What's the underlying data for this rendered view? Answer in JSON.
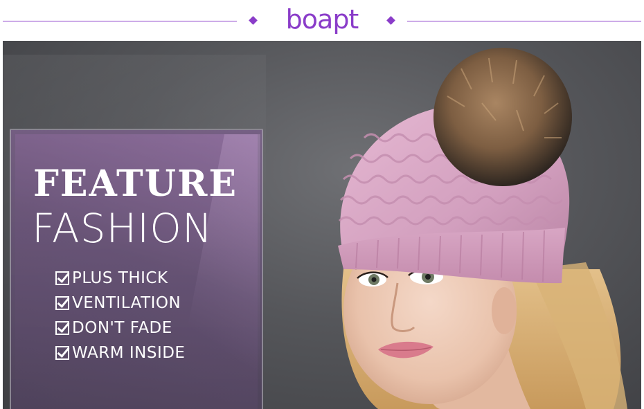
{
  "header": {
    "logo_text": "boapt"
  },
  "banner": {
    "title": "FEATURE",
    "subtitle": "FASHION",
    "features": [
      {
        "icon": "checkbox-checked-icon",
        "label": "PLUS THICK"
      },
      {
        "icon": "checkbox-checked-icon",
        "label": "VENTILATION"
      },
      {
        "icon": "checkbox-checked-icon",
        "label": "DON'T FADE"
      },
      {
        "icon": "checkbox-checked-icon",
        "label": "WARM INSIDE"
      }
    ]
  },
  "colors": {
    "brand": "#8a3cc9",
    "background": "#55565a",
    "hat": "#d9a5c4",
    "pompom": "#8a6a4a",
    "text": "#ffffff"
  }
}
